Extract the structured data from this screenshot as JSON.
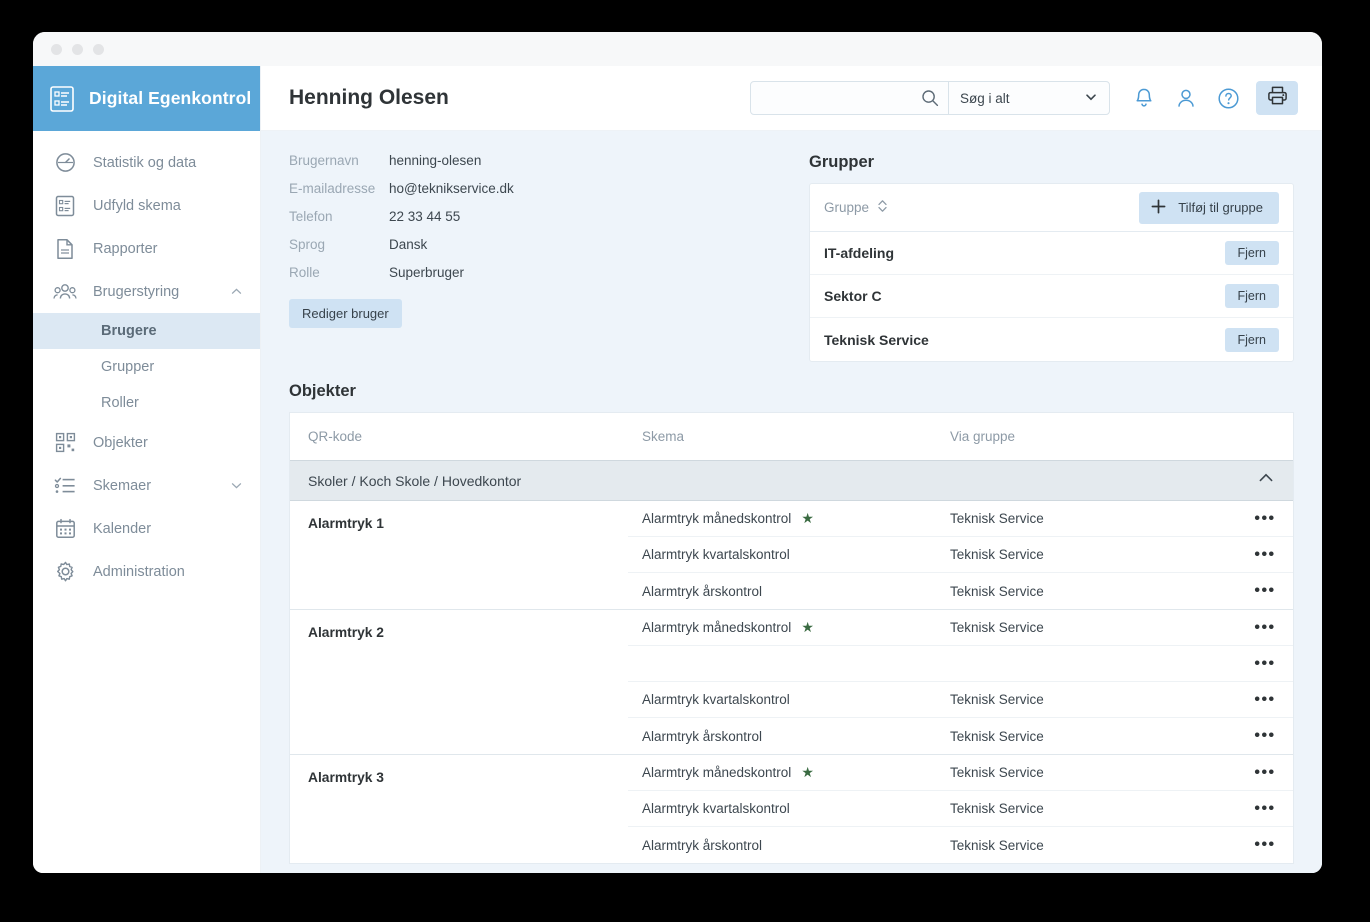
{
  "window": {
    "dots": [
      "",
      "",
      ""
    ]
  },
  "brand": {
    "title": "Digital Egenkontrol",
    "icon": "checklist-icon",
    "bg": "#5ba7d8"
  },
  "sidebar": {
    "items": [
      {
        "label": "Statistik og data",
        "icon": "gauge-icon",
        "chevron": ""
      },
      {
        "label": "Udfyld skema",
        "icon": "checklist-icon",
        "chevron": ""
      },
      {
        "label": "Rapporter",
        "icon": "document-icon",
        "chevron": ""
      },
      {
        "label": "Brugerstyring",
        "icon": "users-icon",
        "chevron": "chevron-up-icon"
      }
    ],
    "sub_items": [
      {
        "label": "Brugere",
        "active": true
      },
      {
        "label": "Grupper",
        "active": false
      },
      {
        "label": "Roller",
        "active": false
      }
    ],
    "items_after": [
      {
        "label": "Objekter",
        "icon": "qr-code-icon",
        "chevron": ""
      },
      {
        "label": "Skemaer",
        "icon": "task-list-icon",
        "chevron": "chevron-down-icon"
      },
      {
        "label": "Kalender",
        "icon": "calendar-icon",
        "chevron": ""
      },
      {
        "label": "Administration",
        "icon": "gear-icon",
        "chevron": ""
      }
    ]
  },
  "topbar": {
    "page_title": "Henning Olesen",
    "search_value": "",
    "search_placeholder": "",
    "search_icon": "search-icon",
    "scope_value": "Søg i alt",
    "scope_chevron": "chevron-down-icon",
    "icons": [
      "bell-icon",
      "user-icon",
      "help-icon"
    ],
    "print_icon": "printer-icon",
    "accent": "#cfe2f3"
  },
  "user": {
    "fields": [
      {
        "label": "Brugernavn",
        "value": "henning-olesen"
      },
      {
        "label": "E-mailadresse",
        "value": "ho@teknikservice.dk"
      },
      {
        "label": "Telefon",
        "value": "22 33 44 55"
      },
      {
        "label": "Sprog",
        "value": "Dansk"
      },
      {
        "label": "Rolle",
        "value": "Superbruger"
      }
    ],
    "edit_label": "Rediger bruger"
  },
  "groups": {
    "title": "Grupper",
    "column_label": "Gruppe",
    "sort_icon": "sort-icon",
    "add_label": "Tilføj til gruppe",
    "add_icon": "plus-icon",
    "remove_label": "Fjern",
    "rows": [
      {
        "name": "IT-afdeling"
      },
      {
        "name": "Sektor C"
      },
      {
        "name": "Teknisk Service"
      }
    ]
  },
  "objects": {
    "title": "Objekter",
    "columns": [
      "QR-kode",
      "Skema",
      "Via gruppe"
    ],
    "group_path": "Skoler  /  Koch Skole  /  Hovedkontor",
    "group_chevron": "chevron-up-icon",
    "menu_icon": "ellipsis-icon",
    "star_icon": "star-icon",
    "star_color": "#3a6b42",
    "groups": [
      {
        "name": "Alarmtryk 1",
        "rows": [
          {
            "skema": "Alarmtryk månedskontrol",
            "star": true,
            "via": "Teknisk Service"
          },
          {
            "skema": "Alarmtryk kvartalskontrol",
            "star": false,
            "via": "Teknisk Service"
          },
          {
            "skema": "Alarmtryk årskontrol",
            "star": false,
            "via": "Teknisk Service"
          }
        ]
      },
      {
        "name": "Alarmtryk 2",
        "rows": [
          {
            "skema": "Alarmtryk månedskontrol",
            "star": true,
            "via": "Teknisk Service"
          },
          {
            "skema": "",
            "star": false,
            "via": ""
          },
          {
            "skema": "Alarmtryk kvartalskontrol",
            "star": false,
            "via": "Teknisk Service"
          },
          {
            "skema": "Alarmtryk årskontrol",
            "star": false,
            "via": "Teknisk Service"
          }
        ]
      },
      {
        "name": "Alarmtryk 3",
        "rows": [
          {
            "skema": "Alarmtryk månedskontrol",
            "star": true,
            "via": "Teknisk Service"
          },
          {
            "skema": "Alarmtryk kvartalskontrol",
            "star": false,
            "via": "Teknisk Service"
          },
          {
            "skema": "Alarmtryk årskontrol",
            "star": false,
            "via": "Teknisk Service"
          }
        ]
      }
    ]
  }
}
